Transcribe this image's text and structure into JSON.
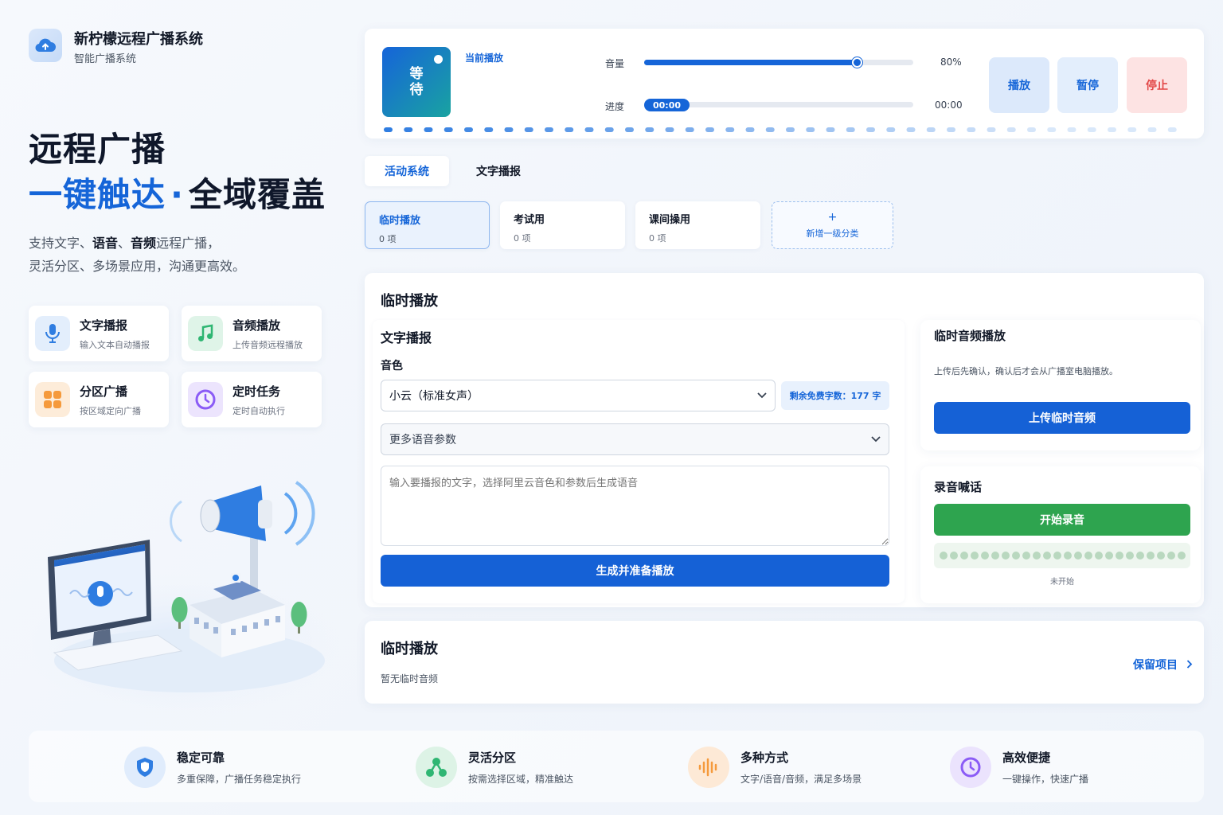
{
  "brand": {
    "name": "新柠檬远程广播系统",
    "subtitle": "智能广播系统"
  },
  "hero": {
    "line1": "远程广播",
    "line2_blue": "一键触达",
    "line2_dot": "·",
    "line2_black": "全域覆盖",
    "desc_line1_pre": "支持文字、",
    "desc_line1_k1": "语音",
    "desc_line1_mid": "、",
    "desc_line1_k2": "音频",
    "desc_line1_post": "远程广播，",
    "desc_line2": "灵活分区、多场景应用，沟通更高效。"
  },
  "features": [
    {
      "title": "文字播报",
      "sub": "输入文本自动播报",
      "icon": "microphone-icon",
      "color": "#2f7de1"
    },
    {
      "title": "音频播放",
      "sub": "上传音频远程播放",
      "icon": "music-note-icon",
      "color": "#2fb673"
    },
    {
      "title": "分区广播",
      "sub": "按区域定向广播",
      "icon": "grid-icon",
      "color": "#f59a3c"
    },
    {
      "title": "定时任务",
      "sub": "定时自动执行",
      "icon": "clock-icon",
      "color": "#8b5cf6"
    }
  ],
  "player": {
    "cover_text": "等\n待",
    "now_playing_label": "当前播放",
    "volume_label": "音量",
    "volume_value": "80%",
    "volume_level": 0.79,
    "progress_label": "进度",
    "progress_current": "00:00",
    "progress_total": "00:00",
    "play_label": "播放",
    "pause_label": "暂停",
    "stop_label": "停止"
  },
  "tabs": [
    {
      "label": "活动系统",
      "active": true
    },
    {
      "label": "文字播报",
      "active": false
    }
  ],
  "categories": [
    {
      "title": "临时播放",
      "count": "0 项",
      "active": true
    },
    {
      "title": "考试用",
      "count": "0 项",
      "active": false
    },
    {
      "title": "课间操用",
      "count": "0 项",
      "active": false
    }
  ],
  "add_category": {
    "plus": "+",
    "label": "新增一级分类"
  },
  "main": {
    "title": "临时播放",
    "tts": {
      "title": "文字播报",
      "voice_label": "音色",
      "voice_value": "小云（标准女声）",
      "quota": "剩余免费字数：177 字",
      "more_params": "更多语音参数",
      "placeholder": "输入要播报的文字，选择阿里云音色和参数后生成语音",
      "generate_label": "生成并准备播放"
    },
    "temp_audio": {
      "title": "临时音频播放",
      "note": "上传后先确认，确认后才会从广播室电脑播放。",
      "upload_label": "上传临时音频"
    },
    "record": {
      "title": "录音喊话",
      "start_label": "开始录音",
      "status": "未开始"
    }
  },
  "list": {
    "title": "临时播放",
    "empty": "暂无临时音频",
    "keep_link": "保留项目"
  },
  "footer": [
    {
      "title": "稳定可靠",
      "sub": "多重保障，广播任务稳定执行",
      "icon": "shield-icon",
      "color": "#2f7de1"
    },
    {
      "title": "灵活分区",
      "sub": "按需选择区域，精准触达",
      "icon": "nodes-icon",
      "color": "#2fb673"
    },
    {
      "title": "多种方式",
      "sub": "文字/语音/音频，满足多场景",
      "icon": "soundwave-icon",
      "color": "#f59a3c"
    },
    {
      "title": "高效便捷",
      "sub": "一键操作，快速广播",
      "icon": "clock-icon",
      "color": "#8b5cf6"
    }
  ]
}
